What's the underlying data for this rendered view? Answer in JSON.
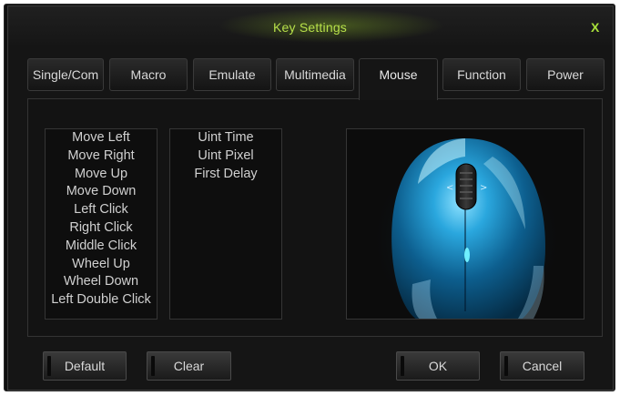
{
  "window": {
    "title": "Key Settings",
    "close_label": "X"
  },
  "tabs": [
    {
      "label": "Single/Com"
    },
    {
      "label": "Macro"
    },
    {
      "label": "Emulate"
    },
    {
      "label": "Multimedia"
    },
    {
      "label": "Mouse",
      "active": true
    },
    {
      "label": "Function"
    },
    {
      "label": "Power"
    }
  ],
  "actions": [
    "Move Left",
    "Move Right",
    "Move Up",
    "Move Down",
    "Left Click",
    "Right Click",
    "Middle Click",
    "Wheel Up",
    "Wheel Down",
    "Left Double Click"
  ],
  "parameters": [
    "Uint Time",
    "Uint Pixel",
    "First Delay"
  ],
  "buttons": {
    "default": "Default",
    "clear": "Clear",
    "ok": "OK",
    "cancel": "Cancel"
  },
  "colors": {
    "accent": "#b7e04a",
    "mouse_blue": "#1e8fc8"
  },
  "icons": {
    "close": "close-icon",
    "preview": "mouse-image"
  }
}
